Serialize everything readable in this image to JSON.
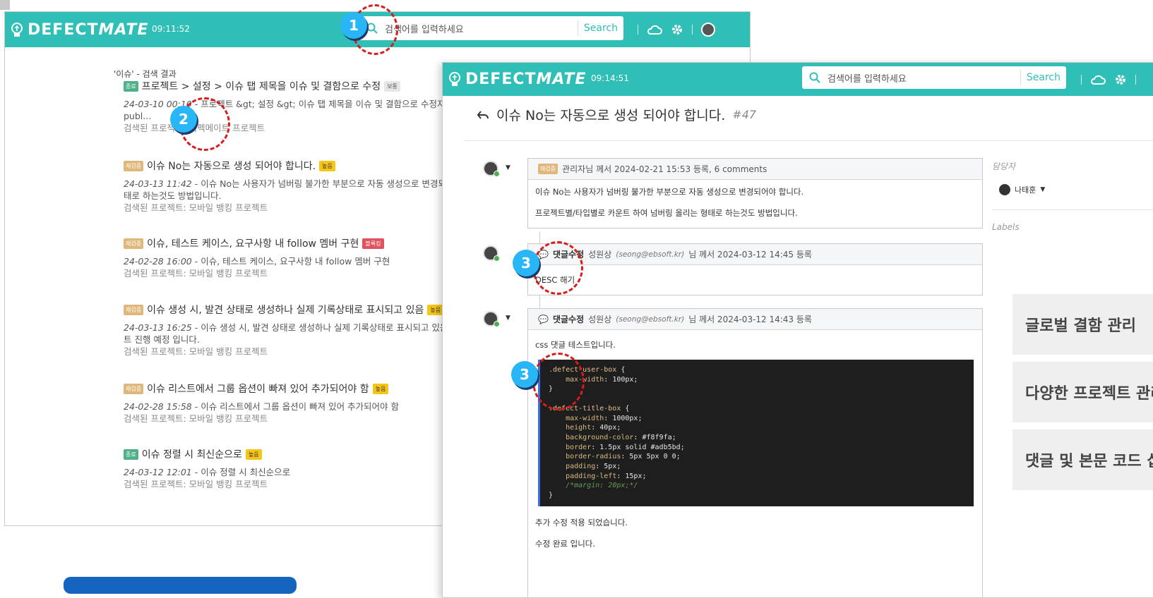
{
  "app": {
    "logo_text": "DEFECT",
    "logo_italic": "MATE"
  },
  "window1": {
    "clock": "09:11:52",
    "search_placeholder": "검색어를 입력하세요",
    "search_button": "Search",
    "results_title": "'이슈' - 검색 결과",
    "results": [
      {
        "status": "종료",
        "title": "프로젝트 > 설정 > 이슈 탭 제목을 이슈 및 결함으로 수정",
        "priority": "보통",
        "time": "24-03-10 00:10",
        "desc": " - 프로젝트 &gt; 설정 &gt; 이슈 탭 제목을 이슈 및 결함으로 수정자바스크립트",
        "desc2": "publ...",
        "project": "검색된 프로젝트: 디펙메이트 프로젝트"
      },
      {
        "status": "재검증",
        "title": "이슈 No는 자동으로 생성 되어야 합니다.",
        "priority": "높음",
        "time": "24-03-13 11:42",
        "desc": " - 이슈 No는 사용자가 넘버링 불가한 부분으로 자동 생성으로 변경되어야 합니다. 프로젝트별/타입별로 카운트 하여 넘버링 올리는 형",
        "desc2": "태로 하는것도 방법입니다.",
        "project": "검색된 프로젝트: 모바일 뱅킹 프로젝트"
      },
      {
        "status": "재검증",
        "title": "이슈, 테스트 케이스, 요구사항 내 follow 멤버 구현",
        "priority": "블록킹",
        "time": "24-02-28 16:00",
        "desc": " - 이슈, 테스트 케이스, 요구사항 내 follow 멤버 구현",
        "desc2": "",
        "project": "검색된 프로젝트: 모바일 뱅킹 프로젝트"
      },
      {
        "status": "재검증",
        "title": "이슈 생성 시, 발견 상태로 생성하나 실제 기록상태로 표시되고 있음",
        "priority": "높음",
        "time": "24-03-13 16:25",
        "desc": " - 이슈 생성 시, 발견 상태로 생성하나 실제 기록상태로 표시되고 있음-수정 완료 이후 테스",
        "desc2": "트 진행 예정 입니다.",
        "project": "검색된 프로젝트: 모바일 뱅킹 프로젝트"
      },
      {
        "status": "재검증",
        "title": "이슈 리스트에서 그룹 옵션이 빠져 있어 추가되어야 함",
        "priority": "높음",
        "time": "24-02-28 15:58",
        "desc": " - 이슈 리스트에서 그룹 옵션이 빠져 있어 추가되어야 함",
        "desc2": "",
        "project": "검색된 프로젝트: 모바일 뱅킹 프로젝트"
      },
      {
        "status": "종료",
        "title": "이슈 정렬 시 최신순으로",
        "priority": "높음",
        "time": "24-03-12 12:01",
        "desc": " - 이슈 정렬 시 최신순으로",
        "desc2": "",
        "project": "검색된 프로젝트: 모바일 뱅킹 프로젝트"
      }
    ]
  },
  "window2": {
    "clock": "09:14:51",
    "search_placeholder": "검색어를 입력하세요",
    "search_button": "Search",
    "issue_title": "이슈 No는 자동으로 생성 되어야 합니다.",
    "issue_number": "#47",
    "main_post": {
      "tag": "재검증",
      "header": "관리자님 께서 2024-02-21 15:53 등록, 6 comments",
      "line1": "이슈 No는 사용자가 넘버링 불가한 부분으로 자동 생성으로 변경되어야 합니다.",
      "line2": "프로젝트별/타입별로 카운트 하여 넘버링 올리는 형태로 하는것도 방법입니다."
    },
    "comment1": {
      "edit": "댓글수정",
      "author": "성원상",
      "email": "(seong@ebsoft.kr)",
      "suffix": "님 께서 2024-03-12 14:45 등록",
      "body": "DESC 해기"
    },
    "comment2": {
      "edit": "댓글수정",
      "author": "성원상",
      "email": "(seong@ebsoft.kr)",
      "suffix": "님 께서 2024-03-12 14:43 등록",
      "body_intro": "css 댓글 테스트입니다.",
      "body_after1": "추가 수정 적용 되었습니다.",
      "body_after2": "수정 완료 입니다."
    },
    "sidebar": {
      "assignee_label": "담당자",
      "assignee_name": "나태훈",
      "labels_label": "Labels"
    },
    "features": [
      "글로벌 결함 관리",
      "다양한 프로젝트 관리",
      "댓글 및 본문 코드 삽입"
    ]
  },
  "markers": [
    "1",
    "2",
    "3",
    "3"
  ],
  "colors": {
    "topbar": "#2fbfb7",
    "annotation": "#d81b1b",
    "marker": "#29b6f6"
  }
}
